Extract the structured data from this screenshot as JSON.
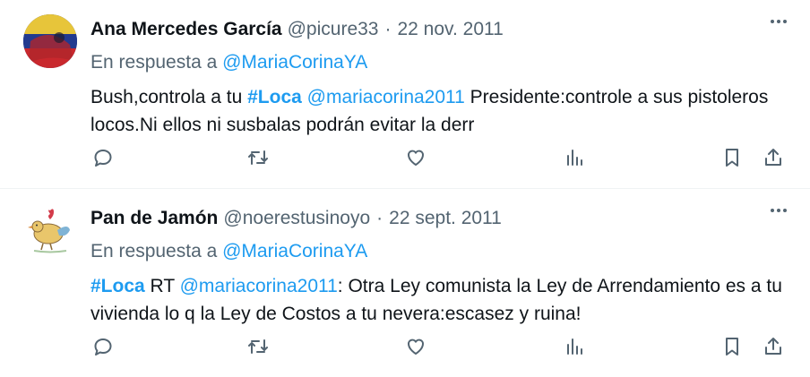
{
  "tweets": [
    {
      "author_name": "Ana Mercedes García",
      "author_handle": "@picure33",
      "separator": "·",
      "date": "22 nov. 2011",
      "reply_prefix": "En respuesta a",
      "reply_handle": "@MariaCorinaYA",
      "text": {
        "part1": "Bush,controla a tu ",
        "hashtag": "#Loca",
        "part2": " ",
        "mention": "@mariacorina2011",
        "part3": " Presidente:controle a sus pistoleros locos.Ni ellos ni susbalas podrán evitar la derr"
      }
    },
    {
      "author_name": "Pan de Jamón",
      "author_handle": "@noerestusinoyo",
      "separator": "·",
      "date": "22 sept. 2011",
      "reply_prefix": "En respuesta a",
      "reply_handle": "@MariaCorinaYA",
      "text": {
        "hashtag": "#Loca",
        "part1": " RT ",
        "mention": "@mariacorina2011",
        "part2": ": Otra Ley comunista la Ley de Arrendamiento es a tu vivienda lo q la Ley de Costos a tu nevera:escasez y ruina!"
      }
    }
  ],
  "icons": {
    "more": "more-icon",
    "reply": "reply-icon",
    "retweet": "retweet-icon",
    "like": "like-icon",
    "views": "views-icon",
    "bookmark": "bookmark-icon",
    "share": "share-icon"
  },
  "colors": {
    "link": "#1d9bf0",
    "secondary_text": "#536471",
    "primary_text": "#0f1419",
    "divider": "#eff3f4"
  }
}
